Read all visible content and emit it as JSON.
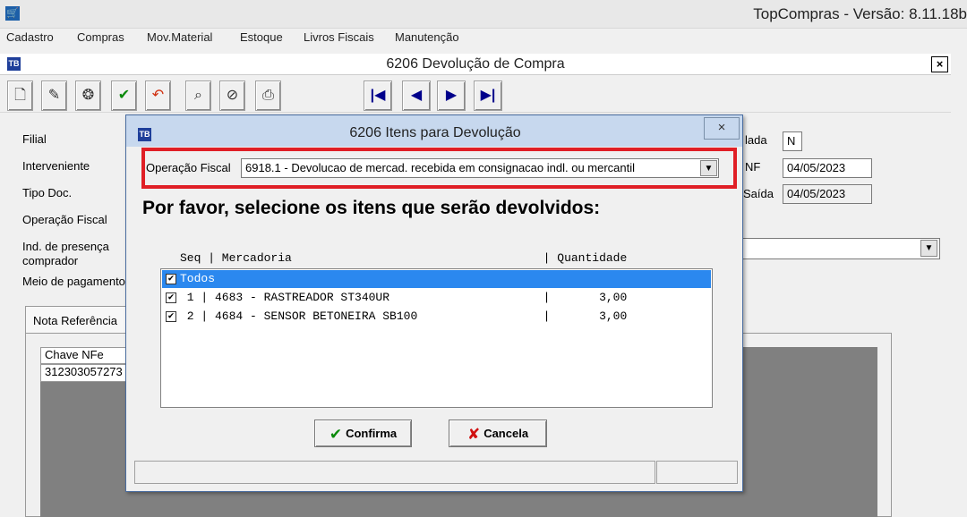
{
  "app": {
    "title": "TopCompras - Versão: 8.11.18b",
    "icon": "cart-icon"
  },
  "menu": [
    "Cadastro",
    "Compras",
    "Mov.Material",
    "Estoque",
    "Livros Fiscais",
    "Manutenção"
  ],
  "window": {
    "title": "6206 Devolução de Compra",
    "close_label": "×"
  },
  "toolbar": {
    "buttons": [
      "new-document-icon",
      "edit-icon",
      "delete-icon",
      "confirm-icon",
      "undo-icon",
      "find-icon",
      "discard-icon",
      "print-icon"
    ],
    "nav": [
      "first-record-icon",
      "previous-record-icon",
      "next-record-icon",
      "last-record-icon"
    ]
  },
  "form": {
    "labels": {
      "filial": "Filial",
      "interveniente": "Interveniente",
      "tipo_doc": "Tipo Doc.",
      "operacao_fiscal": "Operação Fiscal",
      "ind_presenca_1": "Ind. de presença",
      "ind_presenca_2": "comprador",
      "meio_pagamento": "Meio de pagamento",
      "lada": "lada",
      "nf": "NF",
      "saida": "Saída"
    },
    "values": {
      "lada": "N",
      "nf_date": "04/05/2023",
      "saida_date": "04/05/2023"
    },
    "tab": "Nota Referência",
    "grid": {
      "header": "Chave NFe",
      "cell": "312303057273"
    }
  },
  "dialog": {
    "title": "6206  Itens para Devolução",
    "close_label": "×",
    "operacao_label": "Operação Fiscal",
    "operacao_value": "6918.1 - Devolucao de mercad. recebida em consignacao indl. ou mercantil",
    "instruction": "Por favor, selecione os itens que serão devolvidos:",
    "list_header": "Seq | Mercadoria                                    | Quantidade",
    "rows": [
      {
        "text": "Todos",
        "checked": true
      },
      {
        "text": " 1 | 4683 - RASTREADOR ST340UR                      |       3,00",
        "checked": true
      },
      {
        "text": " 2 | 4684 - SENSOR BETONEIRA SB100                  |       3,00",
        "checked": true
      }
    ],
    "confirm_label": "Confirma",
    "cancel_label": "Cancela"
  }
}
